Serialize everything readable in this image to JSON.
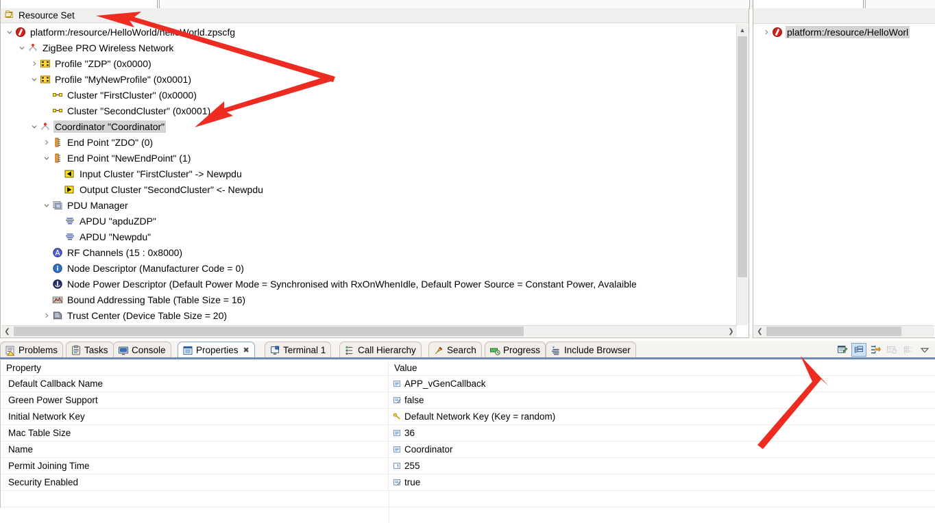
{
  "editor": {
    "resource_set_label": "Resource Set",
    "tree": [
      {
        "indent": 0,
        "twist": "expanded",
        "icon": "zps-file-icon",
        "label": "platform:/resource/HelloWorld/helloWorld.zpscfg",
        "selected": false
      },
      {
        "indent": 1,
        "twist": "expanded",
        "icon": "network-icon",
        "label": "ZigBee PRO Wireless Network",
        "selected": false
      },
      {
        "indent": 2,
        "twist": "collapsed",
        "icon": "profile-icon",
        "label": "Profile \"ZDP\" (0x0000)",
        "selected": false
      },
      {
        "indent": 2,
        "twist": "expanded",
        "icon": "profile-icon",
        "label": "Profile \"MyNewProfile\" (0x0001)",
        "selected": false
      },
      {
        "indent": 3,
        "twist": "none",
        "icon": "cluster-icon",
        "label": "Cluster \"FirstCluster\" (0x0000)",
        "selected": false
      },
      {
        "indent": 3,
        "twist": "none",
        "icon": "cluster-icon",
        "label": "Cluster \"SecondCluster\" (0x0001)",
        "selected": false
      },
      {
        "indent": 2,
        "twist": "expanded",
        "icon": "coordinator-icon",
        "label": "Coordinator \"Coordinator\"",
        "selected": true
      },
      {
        "indent": 3,
        "twist": "collapsed",
        "icon": "endpoint-icon",
        "label": "End Point \"ZDO\" (0)",
        "selected": false
      },
      {
        "indent": 3,
        "twist": "expanded",
        "icon": "endpoint-icon",
        "label": "End Point \"NewEndPoint\" (1)",
        "selected": false
      },
      {
        "indent": 4,
        "twist": "none",
        "icon": "input-cluster-icon",
        "label": "Input Cluster \"FirstCluster\" -> Newpdu",
        "selected": false
      },
      {
        "indent": 4,
        "twist": "none",
        "icon": "output-cluster-icon",
        "label": "Output Cluster \"SecondCluster\" <- Newpdu",
        "selected": false
      },
      {
        "indent": 3,
        "twist": "expanded",
        "icon": "pdu-manager-icon",
        "label": "PDU Manager",
        "selected": false
      },
      {
        "indent": 4,
        "twist": "none",
        "icon": "apdu-icon",
        "label": "APDU \"apduZDP\"",
        "selected": false
      },
      {
        "indent": 4,
        "twist": "none",
        "icon": "apdu-icon",
        "label": "APDU \"Newpdu\"",
        "selected": false
      },
      {
        "indent": 3,
        "twist": "none",
        "icon": "rf-channels-icon",
        "label": "RF Channels (15 : 0x8000)",
        "selected": false
      },
      {
        "indent": 3,
        "twist": "none",
        "icon": "node-descriptor-icon",
        "label": "Node Descriptor (Manufacturer Code = 0)",
        "selected": false
      },
      {
        "indent": 3,
        "twist": "none",
        "icon": "node-power-descriptor-icon",
        "label": "Node Power Descriptor (Default Power Mode = Synchronised with RxOnWhenIdle, Default Power Source = Constant Power, Avalaible",
        "selected": false
      },
      {
        "indent": 3,
        "twist": "none",
        "icon": "bound-address-table-icon",
        "label": "Bound Addressing Table (Table Size = 16)",
        "selected": false
      },
      {
        "indent": 3,
        "twist": "collapsed",
        "icon": "trust-center-icon",
        "label": "Trust Center (Device Table Size = 20)",
        "selected": false
      }
    ]
  },
  "outline": {
    "items": [
      {
        "twist": "collapsed",
        "icon": "zps-file-icon",
        "label": "platform:/resource/HelloWorl"
      }
    ]
  },
  "bottom": {
    "tabs": [
      {
        "id": "problems",
        "label": "Problems",
        "icon": "problems-icon",
        "active": false,
        "closable": false
      },
      {
        "id": "tasks",
        "label": "Tasks",
        "icon": "tasks-icon",
        "active": false,
        "closable": false
      },
      {
        "id": "console",
        "label": "Console",
        "icon": "console-icon",
        "active": false,
        "closable": false
      },
      {
        "id": "properties",
        "label": "Properties",
        "icon": "properties-icon",
        "active": true,
        "closable": true
      },
      {
        "id": "terminal1",
        "label": "Terminal 1",
        "icon": "terminal-icon",
        "active": false,
        "closable": false
      },
      {
        "id": "callhierarchy",
        "label": "Call Hierarchy",
        "icon": "call-hierarchy-icon",
        "active": false,
        "closable": false
      },
      {
        "id": "search",
        "label": "Search",
        "icon": "search-icon",
        "active": false,
        "closable": false
      },
      {
        "id": "progress",
        "label": "Progress",
        "icon": "progress-icon",
        "active": false,
        "closable": false
      },
      {
        "id": "includebrowser",
        "label": "Include Browser",
        "icon": "include-browser-icon",
        "active": false,
        "closable": false
      }
    ],
    "toolbar": [
      {
        "id": "new-property-sheet",
        "icon": "new-property-sheet-icon",
        "state": "normal"
      },
      {
        "id": "show-categories",
        "icon": "show-categories-icon",
        "state": "toggled"
      },
      {
        "id": "show-advanced-properties",
        "icon": "show-advanced-properties-icon",
        "state": "normal"
      },
      {
        "id": "restore-default-value",
        "icon": "restore-default-value-icon",
        "state": "disabled"
      },
      {
        "id": "pin-to-selection",
        "icon": "pin-to-selection-icon",
        "state": "disabled"
      },
      {
        "id": "view-menu",
        "icon": "view-menu-icon",
        "state": "normal"
      }
    ],
    "properties": {
      "columns": [
        "Property",
        "Value"
      ],
      "rows": [
        {
          "property": "Default Callback Name",
          "value": "APP_vGenCallback",
          "value_icon": "string-value-icon"
        },
        {
          "property": "Green Power Support",
          "value": "false",
          "value_icon": "boolean-value-icon"
        },
        {
          "property": "Initial Network Key",
          "value": "Default Network Key (Key = random)",
          "value_icon": "key-value-icon"
        },
        {
          "property": "Mac Table Size",
          "value": "36",
          "value_icon": "string-value-icon"
        },
        {
          "property": "Name",
          "value": "Coordinator",
          "value_icon": "string-value-icon"
        },
        {
          "property": "Permit Joining Time",
          "value": "255",
          "value_icon": "number-value-icon"
        },
        {
          "property": "Security Enabled",
          "value": "true",
          "value_icon": "boolean-value-icon"
        }
      ]
    }
  },
  "annotations": {
    "accent_color": "#ee2b20",
    "arrows": [
      {
        "name": "arrow-to-resource-set"
      },
      {
        "name": "arrow-to-coordinator"
      },
      {
        "name": "arrow-to-advanced-properties-button"
      }
    ]
  }
}
